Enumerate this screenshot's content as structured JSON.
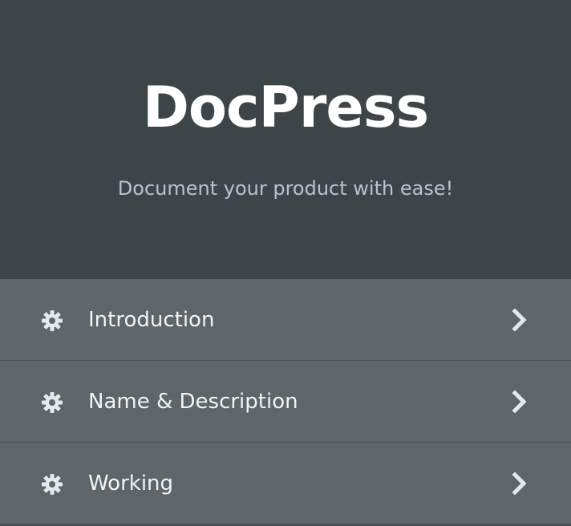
{
  "hero": {
    "title": "DocPress",
    "subtitle": "Document your product with ease!"
  },
  "menu": {
    "items": [
      {
        "label": "Introduction",
        "icon": "gear-icon",
        "trailing_icon": "chevron-right-icon"
      },
      {
        "label": "Name & Description",
        "icon": "gear-icon",
        "trailing_icon": "chevron-right-icon"
      },
      {
        "label": "Working",
        "icon": "gear-icon",
        "trailing_icon": "chevron-right-icon"
      }
    ]
  },
  "colors": {
    "hero_bg": "#3e4548",
    "menu_bg": "#5e6669",
    "title": "#ffffff",
    "subtitle": "#b7c2d3",
    "item_text": "#f2f4f5",
    "icon": "#e6e9eb",
    "divider": "#4e5558"
  }
}
